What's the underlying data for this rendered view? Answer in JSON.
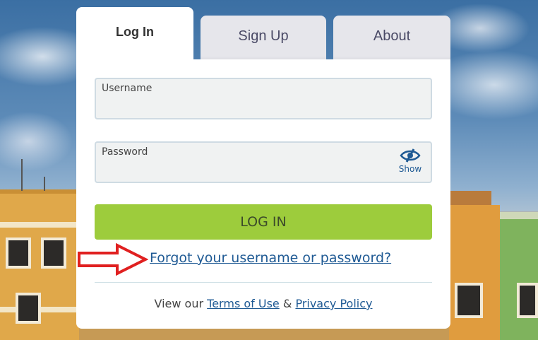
{
  "tabs": {
    "login": "Log In",
    "signup": "Sign Up",
    "about": "About"
  },
  "form": {
    "username_label": "Username",
    "username_value": "",
    "password_label": "Password",
    "password_value": "",
    "show_label": "Show",
    "login_button": "LOG IN",
    "forgot_link": "Forgot your username or password?"
  },
  "footer": {
    "prefix": "View our",
    "terms": "Terms of Use",
    "amp": "&",
    "privacy": "Privacy Policy"
  },
  "colors": {
    "accent_green": "#9dcc3c",
    "link_blue": "#1f5a94",
    "arrow_red": "#e02020"
  },
  "icons": {
    "show_password": "eye-slash-icon",
    "annotation": "red-arrow-icon"
  }
}
